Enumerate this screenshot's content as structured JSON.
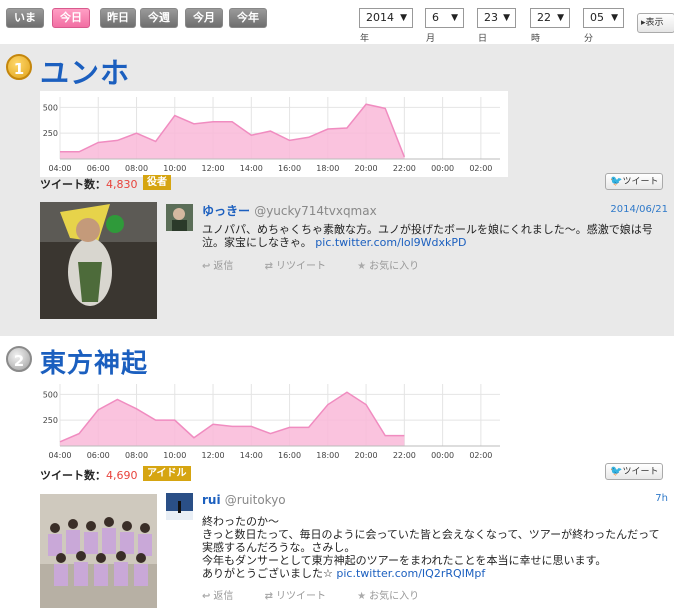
{
  "nav": {
    "periods": [
      "いま",
      "今日",
      "昨日",
      "今週",
      "今月",
      "今年"
    ],
    "active_period": "今日",
    "date": {
      "year": "2014",
      "month": "6",
      "day": "23",
      "hour": "22",
      "minute": "05"
    },
    "units": {
      "year": "年",
      "month": "月",
      "day": "日",
      "hour": "時",
      "minute": "分"
    },
    "show_label": "▸表示"
  },
  "colors": {
    "accent": "#1b5fbf",
    "chart_fill": "#f9b9d8",
    "chart_line": "#f08cc0",
    "tag_bg": "#d6a511",
    "count_num": "#e8433c"
  },
  "entries": [
    {
      "rank": "1",
      "medal": "gold",
      "name": "ユンホ",
      "count_label": "ツイート数：",
      "count_value": "4,830",
      "category": "役者",
      "tweet_button": "ツイート",
      "tweet": {
        "user_name": "ゆっきー",
        "handle": "@yucky714tvxqmax",
        "date": "2014/06/21",
        "text": "ユノパパ、めちゃくちゃ素敵な方。ユノが投げたボールを娘にくれました〜。感激で娘は号泣。家宝にしなきゃ。",
        "link": "pic.twitter.com/lol9WdxkPD",
        "actions": [
          "返信",
          "リツイート",
          "お気に入り"
        ]
      }
    },
    {
      "rank": "2",
      "medal": "silver",
      "name": "東方神起",
      "count_label": "ツイート数：",
      "count_value": "4,690",
      "category": "アイドル",
      "tweet_button": "ツイート",
      "tweet": {
        "user_name": "rui",
        "handle": "@ruitokyo",
        "date": "7h",
        "lines": [
          "終わったのか〜",
          "きっと数日たって、毎日のように会っていた皆と会えなくなって、ツアーが終わったんだって",
          "実感するんだろうな。さみし。",
          "今年もダンサーとして東方神起のツアーをまわれたことを本当に幸せに思います。"
        ],
        "last_line": "ありがとうございました☆",
        "link": "pic.twitter.com/IQ2rRQIMpf",
        "actions": [
          "返信",
          "リツイート",
          "お気に入り"
        ]
      }
    }
  ],
  "chart_data": [
    {
      "type": "area",
      "x": [
        "04:00",
        "05:00",
        "06:00",
        "07:00",
        "08:00",
        "09:00",
        "10:00",
        "11:00",
        "12:00",
        "13:00",
        "14:00",
        "15:00",
        "16:00",
        "17:00",
        "18:00",
        "19:00",
        "20:00",
        "21:00",
        "22:00"
      ],
      "x_ticks": [
        "04:00",
        "06:00",
        "08:00",
        "10:00",
        "12:00",
        "14:00",
        "16:00",
        "18:00",
        "20:00",
        "22:00",
        "00:00",
        "02:00"
      ],
      "values": [
        70,
        70,
        160,
        180,
        250,
        170,
        420,
        340,
        360,
        360,
        230,
        270,
        180,
        210,
        290,
        300,
        530,
        490,
        20
      ],
      "yticks": [
        250,
        500
      ],
      "ylim": [
        0,
        600
      ],
      "xlim": [
        "04:00",
        "03:00"
      ]
    },
    {
      "type": "area",
      "x": [
        "04:00",
        "05:00",
        "06:00",
        "07:00",
        "08:00",
        "09:00",
        "10:00",
        "11:00",
        "12:00",
        "13:00",
        "14:00",
        "15:00",
        "16:00",
        "17:00",
        "18:00",
        "19:00",
        "20:00",
        "21:00",
        "22:00"
      ],
      "x_ticks": [
        "04:00",
        "06:00",
        "08:00",
        "10:00",
        "12:00",
        "14:00",
        "16:00",
        "18:00",
        "20:00",
        "22:00",
        "00:00",
        "02:00"
      ],
      "values": [
        40,
        120,
        350,
        450,
        360,
        250,
        250,
        80,
        210,
        190,
        190,
        120,
        180,
        180,
        400,
        520,
        400,
        100,
        100
      ],
      "yticks": [
        250,
        500
      ],
      "ylim": [
        0,
        600
      ],
      "xlim": [
        "04:00",
        "03:00"
      ]
    }
  ]
}
